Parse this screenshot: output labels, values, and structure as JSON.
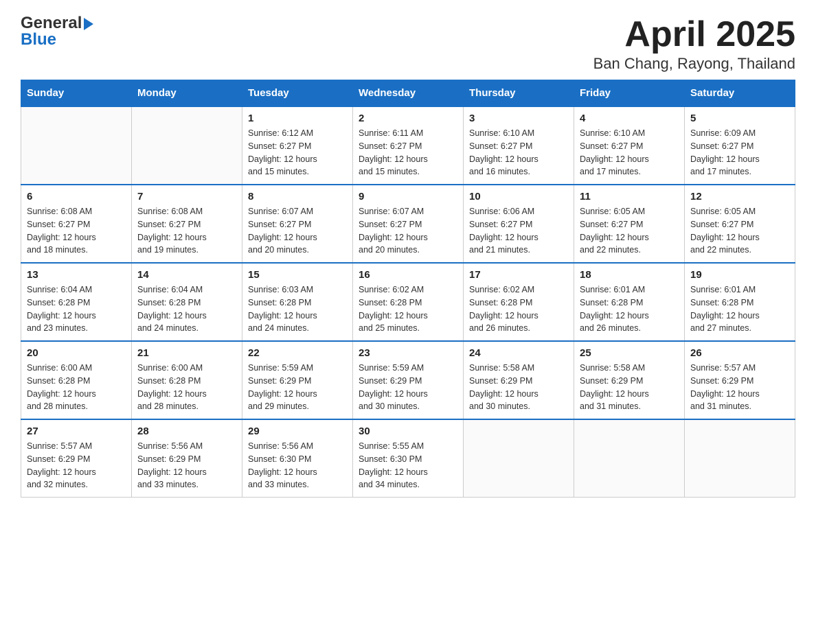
{
  "header": {
    "title": "April 2025",
    "subtitle": "Ban Chang, Rayong, Thailand",
    "logo_general": "General",
    "logo_blue": "Blue"
  },
  "weekdays": [
    "Sunday",
    "Monday",
    "Tuesday",
    "Wednesday",
    "Thursday",
    "Friday",
    "Saturday"
  ],
  "weeks": [
    [
      {
        "day": "",
        "info": ""
      },
      {
        "day": "",
        "info": ""
      },
      {
        "day": "1",
        "info": "Sunrise: 6:12 AM\nSunset: 6:27 PM\nDaylight: 12 hours\nand 15 minutes."
      },
      {
        "day": "2",
        "info": "Sunrise: 6:11 AM\nSunset: 6:27 PM\nDaylight: 12 hours\nand 15 minutes."
      },
      {
        "day": "3",
        "info": "Sunrise: 6:10 AM\nSunset: 6:27 PM\nDaylight: 12 hours\nand 16 minutes."
      },
      {
        "day": "4",
        "info": "Sunrise: 6:10 AM\nSunset: 6:27 PM\nDaylight: 12 hours\nand 17 minutes."
      },
      {
        "day": "5",
        "info": "Sunrise: 6:09 AM\nSunset: 6:27 PM\nDaylight: 12 hours\nand 17 minutes."
      }
    ],
    [
      {
        "day": "6",
        "info": "Sunrise: 6:08 AM\nSunset: 6:27 PM\nDaylight: 12 hours\nand 18 minutes."
      },
      {
        "day": "7",
        "info": "Sunrise: 6:08 AM\nSunset: 6:27 PM\nDaylight: 12 hours\nand 19 minutes."
      },
      {
        "day": "8",
        "info": "Sunrise: 6:07 AM\nSunset: 6:27 PM\nDaylight: 12 hours\nand 20 minutes."
      },
      {
        "day": "9",
        "info": "Sunrise: 6:07 AM\nSunset: 6:27 PM\nDaylight: 12 hours\nand 20 minutes."
      },
      {
        "day": "10",
        "info": "Sunrise: 6:06 AM\nSunset: 6:27 PM\nDaylight: 12 hours\nand 21 minutes."
      },
      {
        "day": "11",
        "info": "Sunrise: 6:05 AM\nSunset: 6:27 PM\nDaylight: 12 hours\nand 22 minutes."
      },
      {
        "day": "12",
        "info": "Sunrise: 6:05 AM\nSunset: 6:27 PM\nDaylight: 12 hours\nand 22 minutes."
      }
    ],
    [
      {
        "day": "13",
        "info": "Sunrise: 6:04 AM\nSunset: 6:28 PM\nDaylight: 12 hours\nand 23 minutes."
      },
      {
        "day": "14",
        "info": "Sunrise: 6:04 AM\nSunset: 6:28 PM\nDaylight: 12 hours\nand 24 minutes."
      },
      {
        "day": "15",
        "info": "Sunrise: 6:03 AM\nSunset: 6:28 PM\nDaylight: 12 hours\nand 24 minutes."
      },
      {
        "day": "16",
        "info": "Sunrise: 6:02 AM\nSunset: 6:28 PM\nDaylight: 12 hours\nand 25 minutes."
      },
      {
        "day": "17",
        "info": "Sunrise: 6:02 AM\nSunset: 6:28 PM\nDaylight: 12 hours\nand 26 minutes."
      },
      {
        "day": "18",
        "info": "Sunrise: 6:01 AM\nSunset: 6:28 PM\nDaylight: 12 hours\nand 26 minutes."
      },
      {
        "day": "19",
        "info": "Sunrise: 6:01 AM\nSunset: 6:28 PM\nDaylight: 12 hours\nand 27 minutes."
      }
    ],
    [
      {
        "day": "20",
        "info": "Sunrise: 6:00 AM\nSunset: 6:28 PM\nDaylight: 12 hours\nand 28 minutes."
      },
      {
        "day": "21",
        "info": "Sunrise: 6:00 AM\nSunset: 6:28 PM\nDaylight: 12 hours\nand 28 minutes."
      },
      {
        "day": "22",
        "info": "Sunrise: 5:59 AM\nSunset: 6:29 PM\nDaylight: 12 hours\nand 29 minutes."
      },
      {
        "day": "23",
        "info": "Sunrise: 5:59 AM\nSunset: 6:29 PM\nDaylight: 12 hours\nand 30 minutes."
      },
      {
        "day": "24",
        "info": "Sunrise: 5:58 AM\nSunset: 6:29 PM\nDaylight: 12 hours\nand 30 minutes."
      },
      {
        "day": "25",
        "info": "Sunrise: 5:58 AM\nSunset: 6:29 PM\nDaylight: 12 hours\nand 31 minutes."
      },
      {
        "day": "26",
        "info": "Sunrise: 5:57 AM\nSunset: 6:29 PM\nDaylight: 12 hours\nand 31 minutes."
      }
    ],
    [
      {
        "day": "27",
        "info": "Sunrise: 5:57 AM\nSunset: 6:29 PM\nDaylight: 12 hours\nand 32 minutes."
      },
      {
        "day": "28",
        "info": "Sunrise: 5:56 AM\nSunset: 6:29 PM\nDaylight: 12 hours\nand 33 minutes."
      },
      {
        "day": "29",
        "info": "Sunrise: 5:56 AM\nSunset: 6:30 PM\nDaylight: 12 hours\nand 33 minutes."
      },
      {
        "day": "30",
        "info": "Sunrise: 5:55 AM\nSunset: 6:30 PM\nDaylight: 12 hours\nand 34 minutes."
      },
      {
        "day": "",
        "info": ""
      },
      {
        "day": "",
        "info": ""
      },
      {
        "day": "",
        "info": ""
      }
    ]
  ]
}
